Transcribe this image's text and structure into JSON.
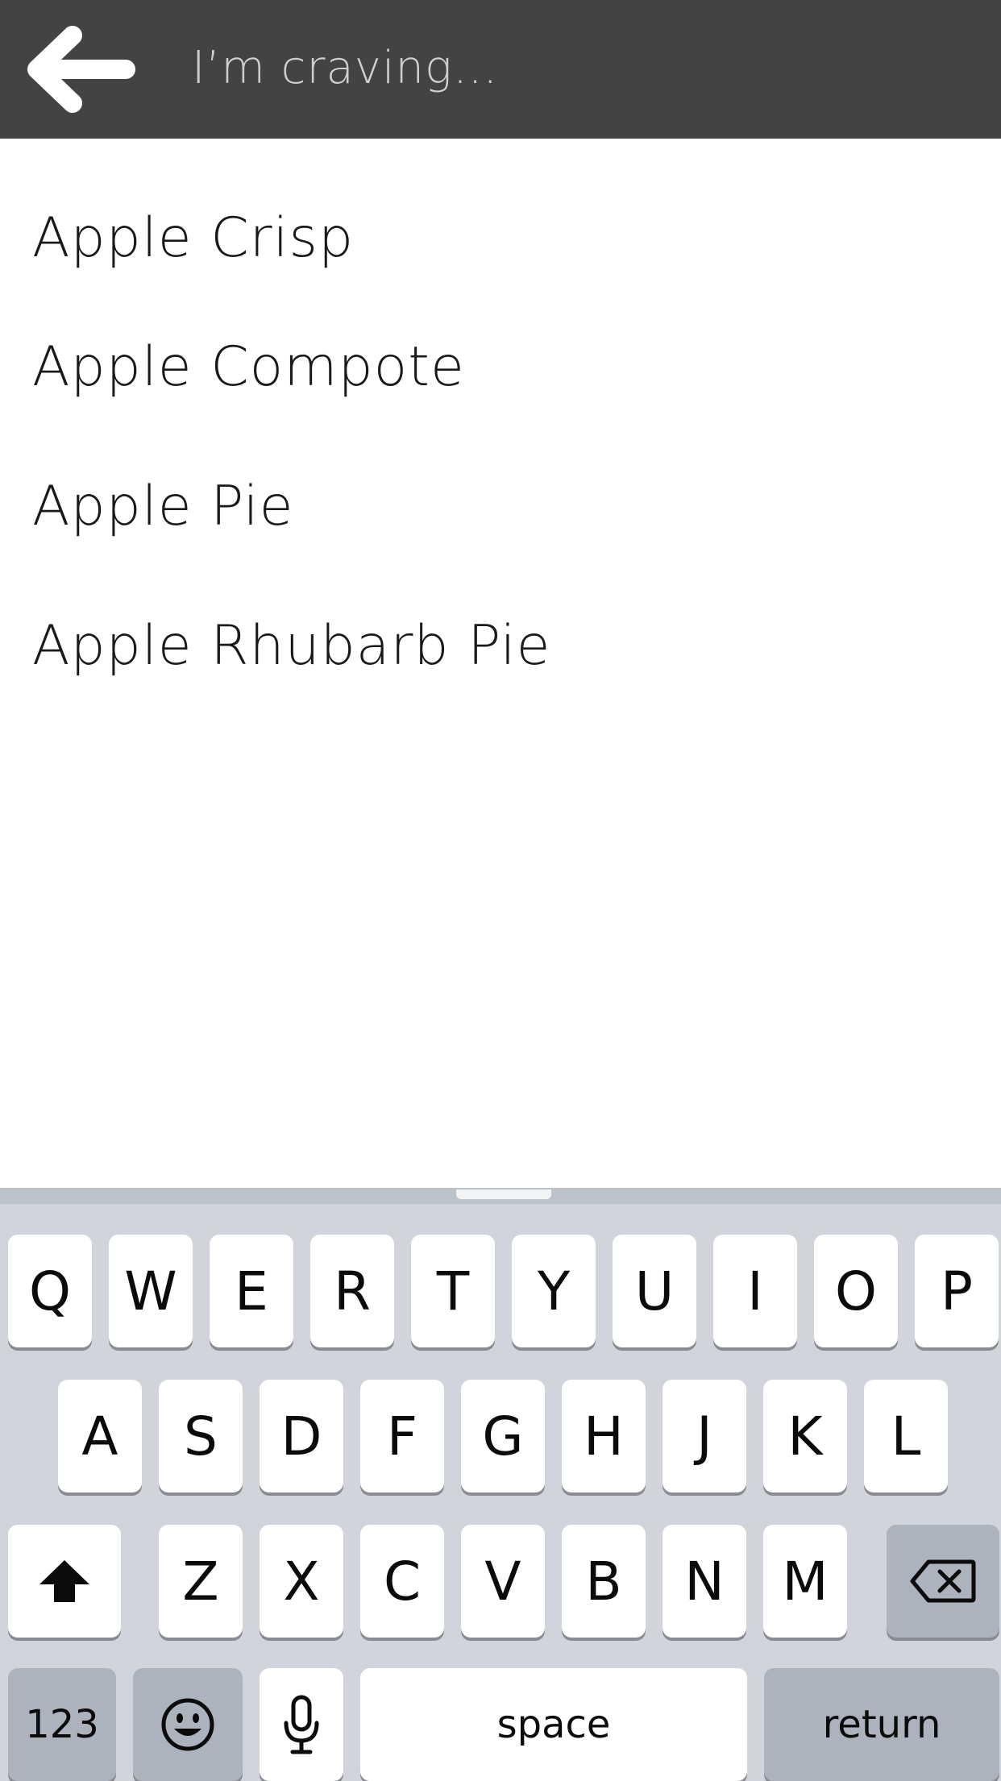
{
  "header": {
    "search_placeholder": "I’m craving…",
    "background_color": "#434344"
  },
  "suggestions": [
    {
      "label": "Apple Crisp"
    },
    {
      "label": "Apple Compote"
    },
    {
      "label": "Apple Pie"
    },
    {
      "label": "Apple Rhubarb Pie"
    }
  ],
  "keyboard": {
    "row1": [
      "Q",
      "W",
      "E",
      "R",
      "T",
      "Y",
      "U",
      "I",
      "O",
      "P"
    ],
    "row2": [
      "A",
      "S",
      "D",
      "F",
      "G",
      "H",
      "J",
      "K",
      "L"
    ],
    "row3": [
      "Z",
      "X",
      "C",
      "V",
      "B",
      "N",
      "M"
    ],
    "numbers_label": "123",
    "space_label": "space",
    "return_label": "return",
    "icons": {
      "shift": "shift-icon",
      "delete": "backspace-icon",
      "emoji": "emoji-icon",
      "mic": "microphone-icon",
      "back": "back-arrow-icon"
    }
  }
}
